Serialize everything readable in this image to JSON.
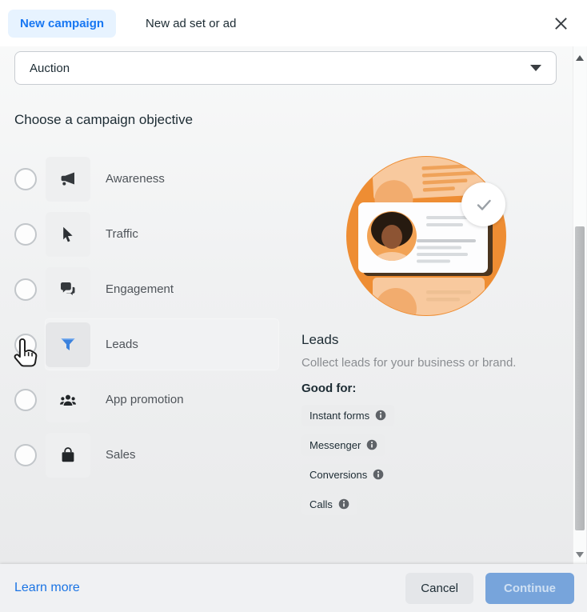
{
  "header": {
    "tabs": [
      {
        "label": "New campaign",
        "active": true
      },
      {
        "label": "New ad set or ad",
        "active": false
      }
    ]
  },
  "buying_type": {
    "value": "Auction"
  },
  "objectives": {
    "heading": "Choose a campaign objective",
    "options": [
      {
        "label": "Awareness",
        "icon": "megaphone-icon",
        "selected": false,
        "highlighted": false
      },
      {
        "label": "Traffic",
        "icon": "cursor-icon",
        "selected": false,
        "highlighted": false
      },
      {
        "label": "Engagement",
        "icon": "chat-bubbles-icon",
        "selected": false,
        "highlighted": false
      },
      {
        "label": "Leads",
        "icon": "funnel-icon",
        "selected": false,
        "highlighted": true
      },
      {
        "label": "App promotion",
        "icon": "people-icon",
        "selected": false,
        "highlighted": false
      },
      {
        "label": "Sales",
        "icon": "shopping-bag-icon",
        "selected": false,
        "highlighted": false
      }
    ]
  },
  "detail": {
    "title": "Leads",
    "description": "Collect leads for your business or brand.",
    "good_for_label": "Good for:",
    "tags": [
      "Instant forms",
      "Messenger",
      "Conversions",
      "Calls"
    ]
  },
  "footer": {
    "learn_more_label": "Learn more",
    "cancel_label": "Cancel",
    "continue_label": "Continue",
    "continue_enabled": false
  },
  "colors": {
    "accent": "#1877f2",
    "tab_bg": "#e7f3ff",
    "illustration_orange": "#ee8d33",
    "funnel_blue": "#3c82dd",
    "continue_disabled_bg": "#77a4db"
  }
}
